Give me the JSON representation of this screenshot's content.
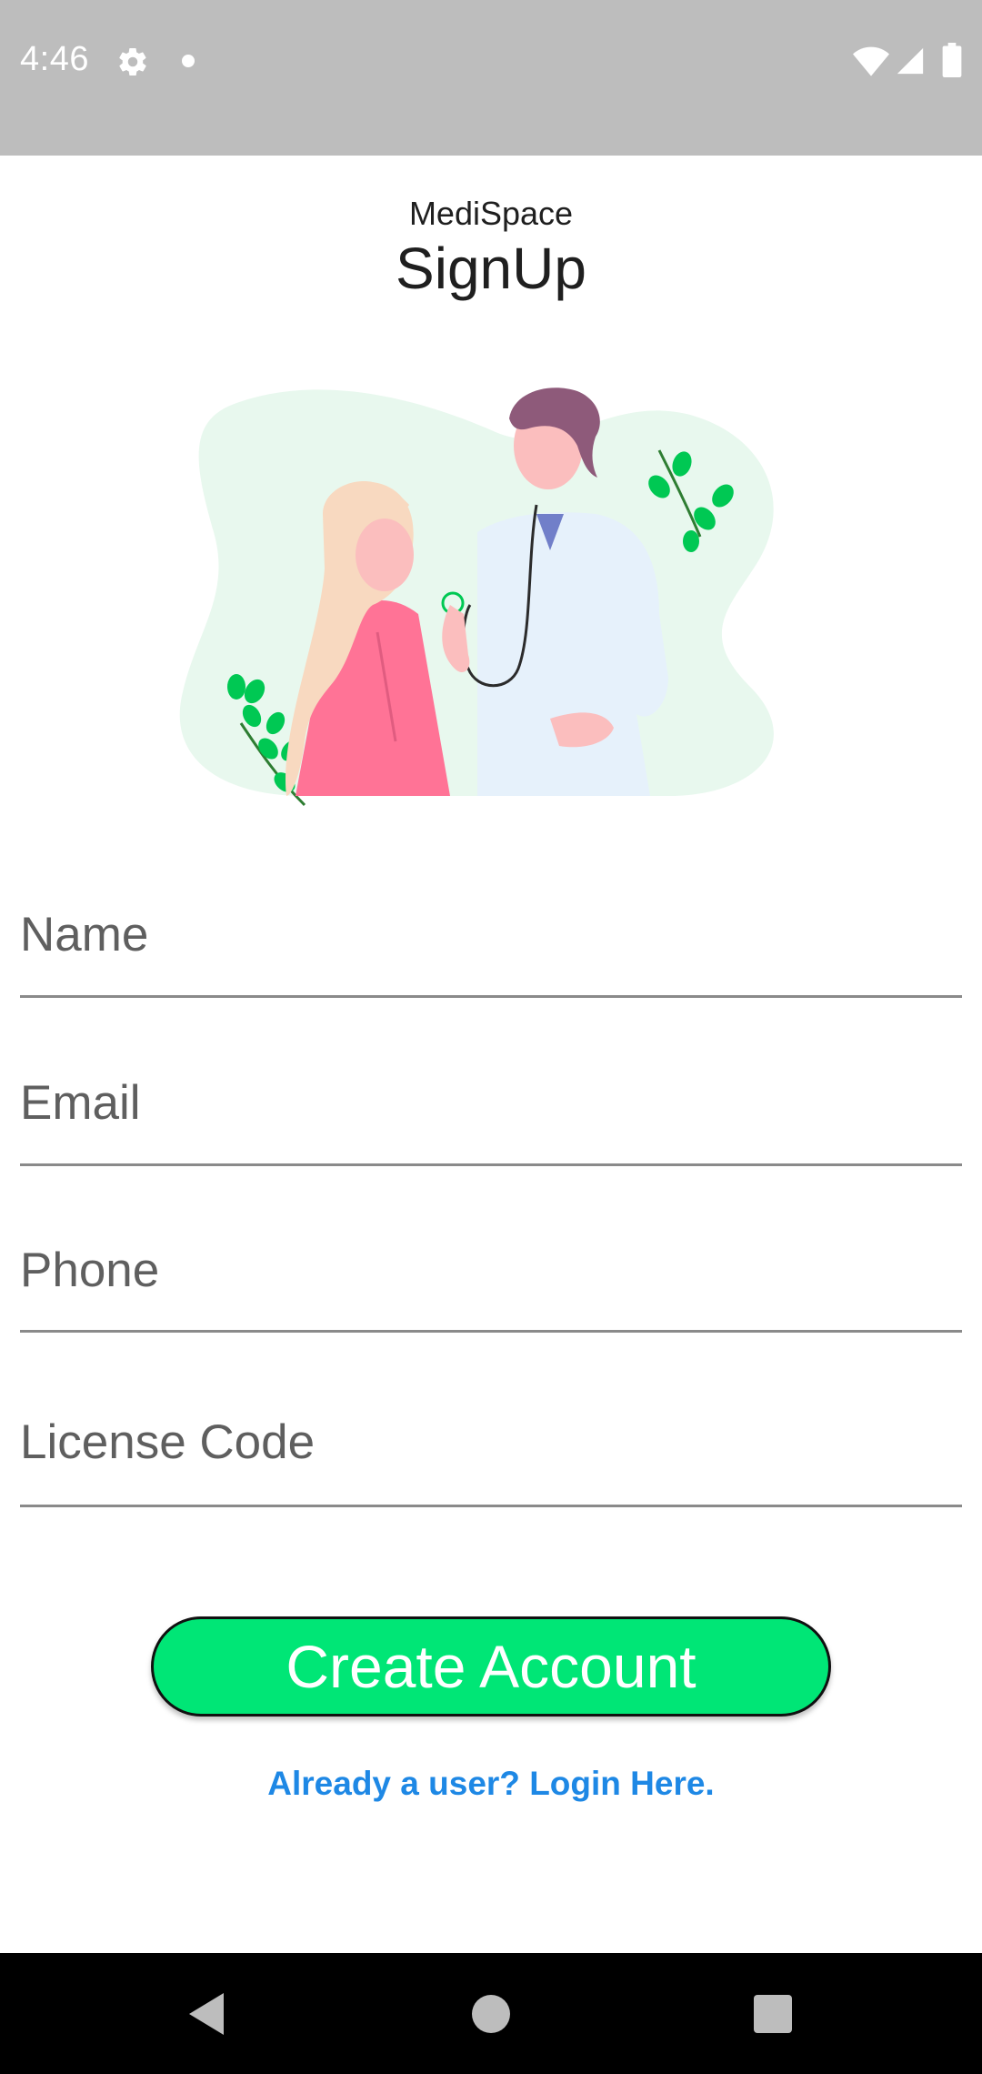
{
  "status_bar": {
    "time": "4:46",
    "icons": [
      "gear-icon",
      "notification-dot-icon",
      "wifi-icon",
      "signal-icon",
      "battery-icon"
    ]
  },
  "header": {
    "app_name": "MediSpace",
    "title": "SignUp"
  },
  "illustration": {
    "description_icon": "doctor-patient-illustration"
  },
  "form": {
    "name_placeholder": "Name",
    "email_placeholder": "Email",
    "phone_placeholder": "Phone",
    "license_placeholder": "License Code"
  },
  "actions": {
    "create_account_label": "Create Account",
    "login_link_label": "Already a user? Login Here."
  },
  "colors": {
    "status_bar": "#bdbdbd",
    "accent_green": "#00e676",
    "link_blue": "#1e88e5",
    "nav_bar": "#000000"
  },
  "nav_bar": {
    "icons": [
      "back-icon",
      "home-icon",
      "recents-icon"
    ]
  }
}
